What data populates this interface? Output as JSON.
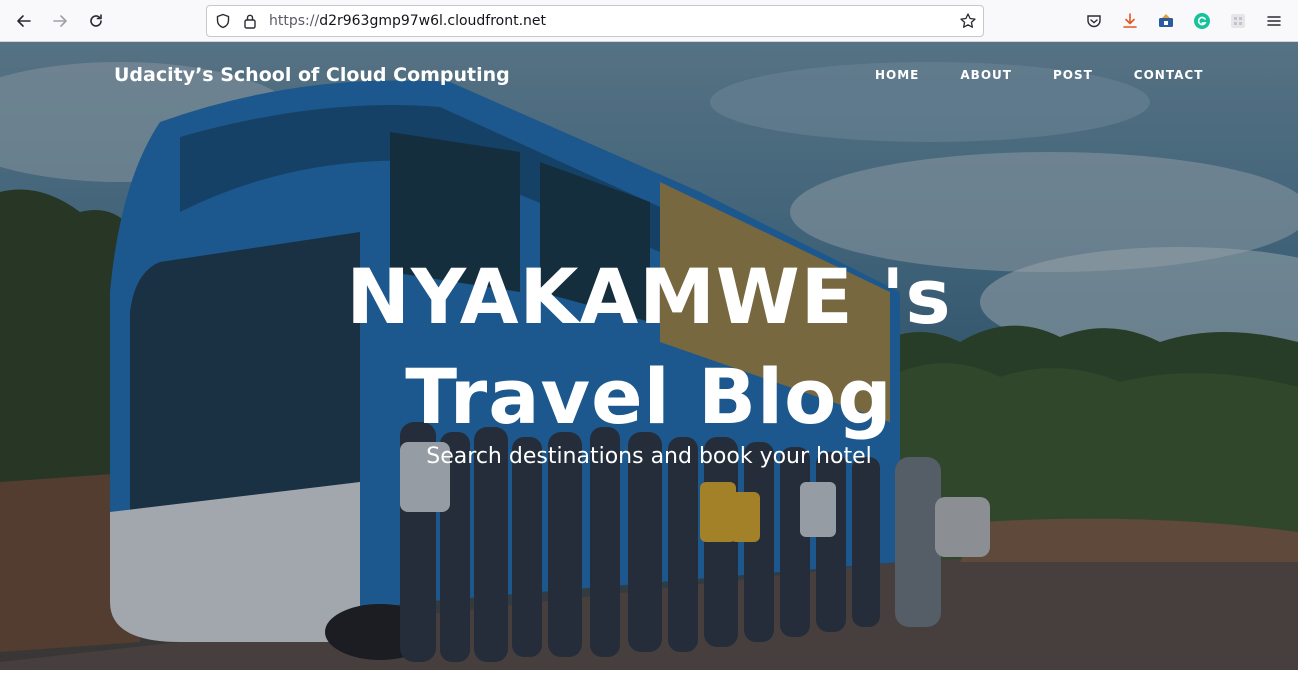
{
  "browser": {
    "url_scheme": "https://",
    "url_host": "d2r963gmp97w6l.cloudfront.net",
    "icons": [
      "back-icon",
      "forward-icon",
      "reload-icon",
      "shield-icon",
      "lock-icon",
      "bookmark-star-icon",
      "pocket-icon",
      "download-icon",
      "extension-icon",
      "grammarly-icon",
      "extension-grid-icon",
      "menu-icon"
    ]
  },
  "site": {
    "brand": "Udacity’s School of Cloud Computing",
    "nav": [
      "HOME",
      "ABOUT",
      "POST",
      "CONTACT"
    ],
    "hero": {
      "title_line1": "NYAKAMWE 's",
      "title_line2": "Travel Blog",
      "subtitle": "Search destinations and book your hotel"
    }
  },
  "colors": {
    "accent_download": "#e25920",
    "grammarly": "#15c39a"
  }
}
